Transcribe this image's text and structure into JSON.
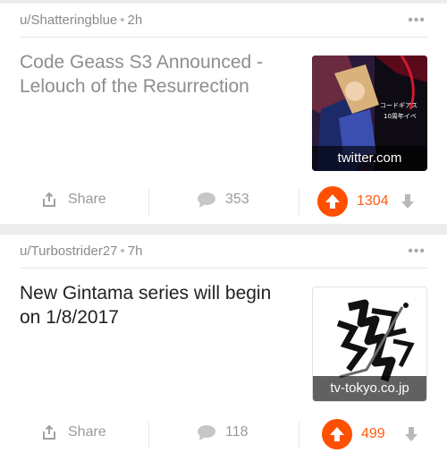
{
  "posts": [
    {
      "author": "u/Shatteringblue",
      "age": "2h",
      "title": "Code Geass S3 Announced - Lelouch of the Resurrection",
      "domain": "twitter.com",
      "share_label": "Share",
      "comments": "353",
      "score": "1304"
    },
    {
      "author": "u/Turbostrider27",
      "age": "7h",
      "title": "New Gintama series will begin on 1/8/2017",
      "domain": "tv-tokyo.co.jp",
      "share_label": "Share",
      "comments": "118",
      "score": "499"
    }
  ],
  "icons": {
    "more": "more-options-icon",
    "share": "share-icon",
    "comment": "comment-icon",
    "upvote": "upvote-arrow-icon",
    "downvote": "downvote-arrow-icon"
  },
  "thumb_text": {
    "geass_line1": "コードギアス",
    "geass_line2": "10周年イベ"
  },
  "colors": {
    "upvote_active": "#ff4f00",
    "score_active": "#ff5a10",
    "muted": "#9a9a9a"
  }
}
